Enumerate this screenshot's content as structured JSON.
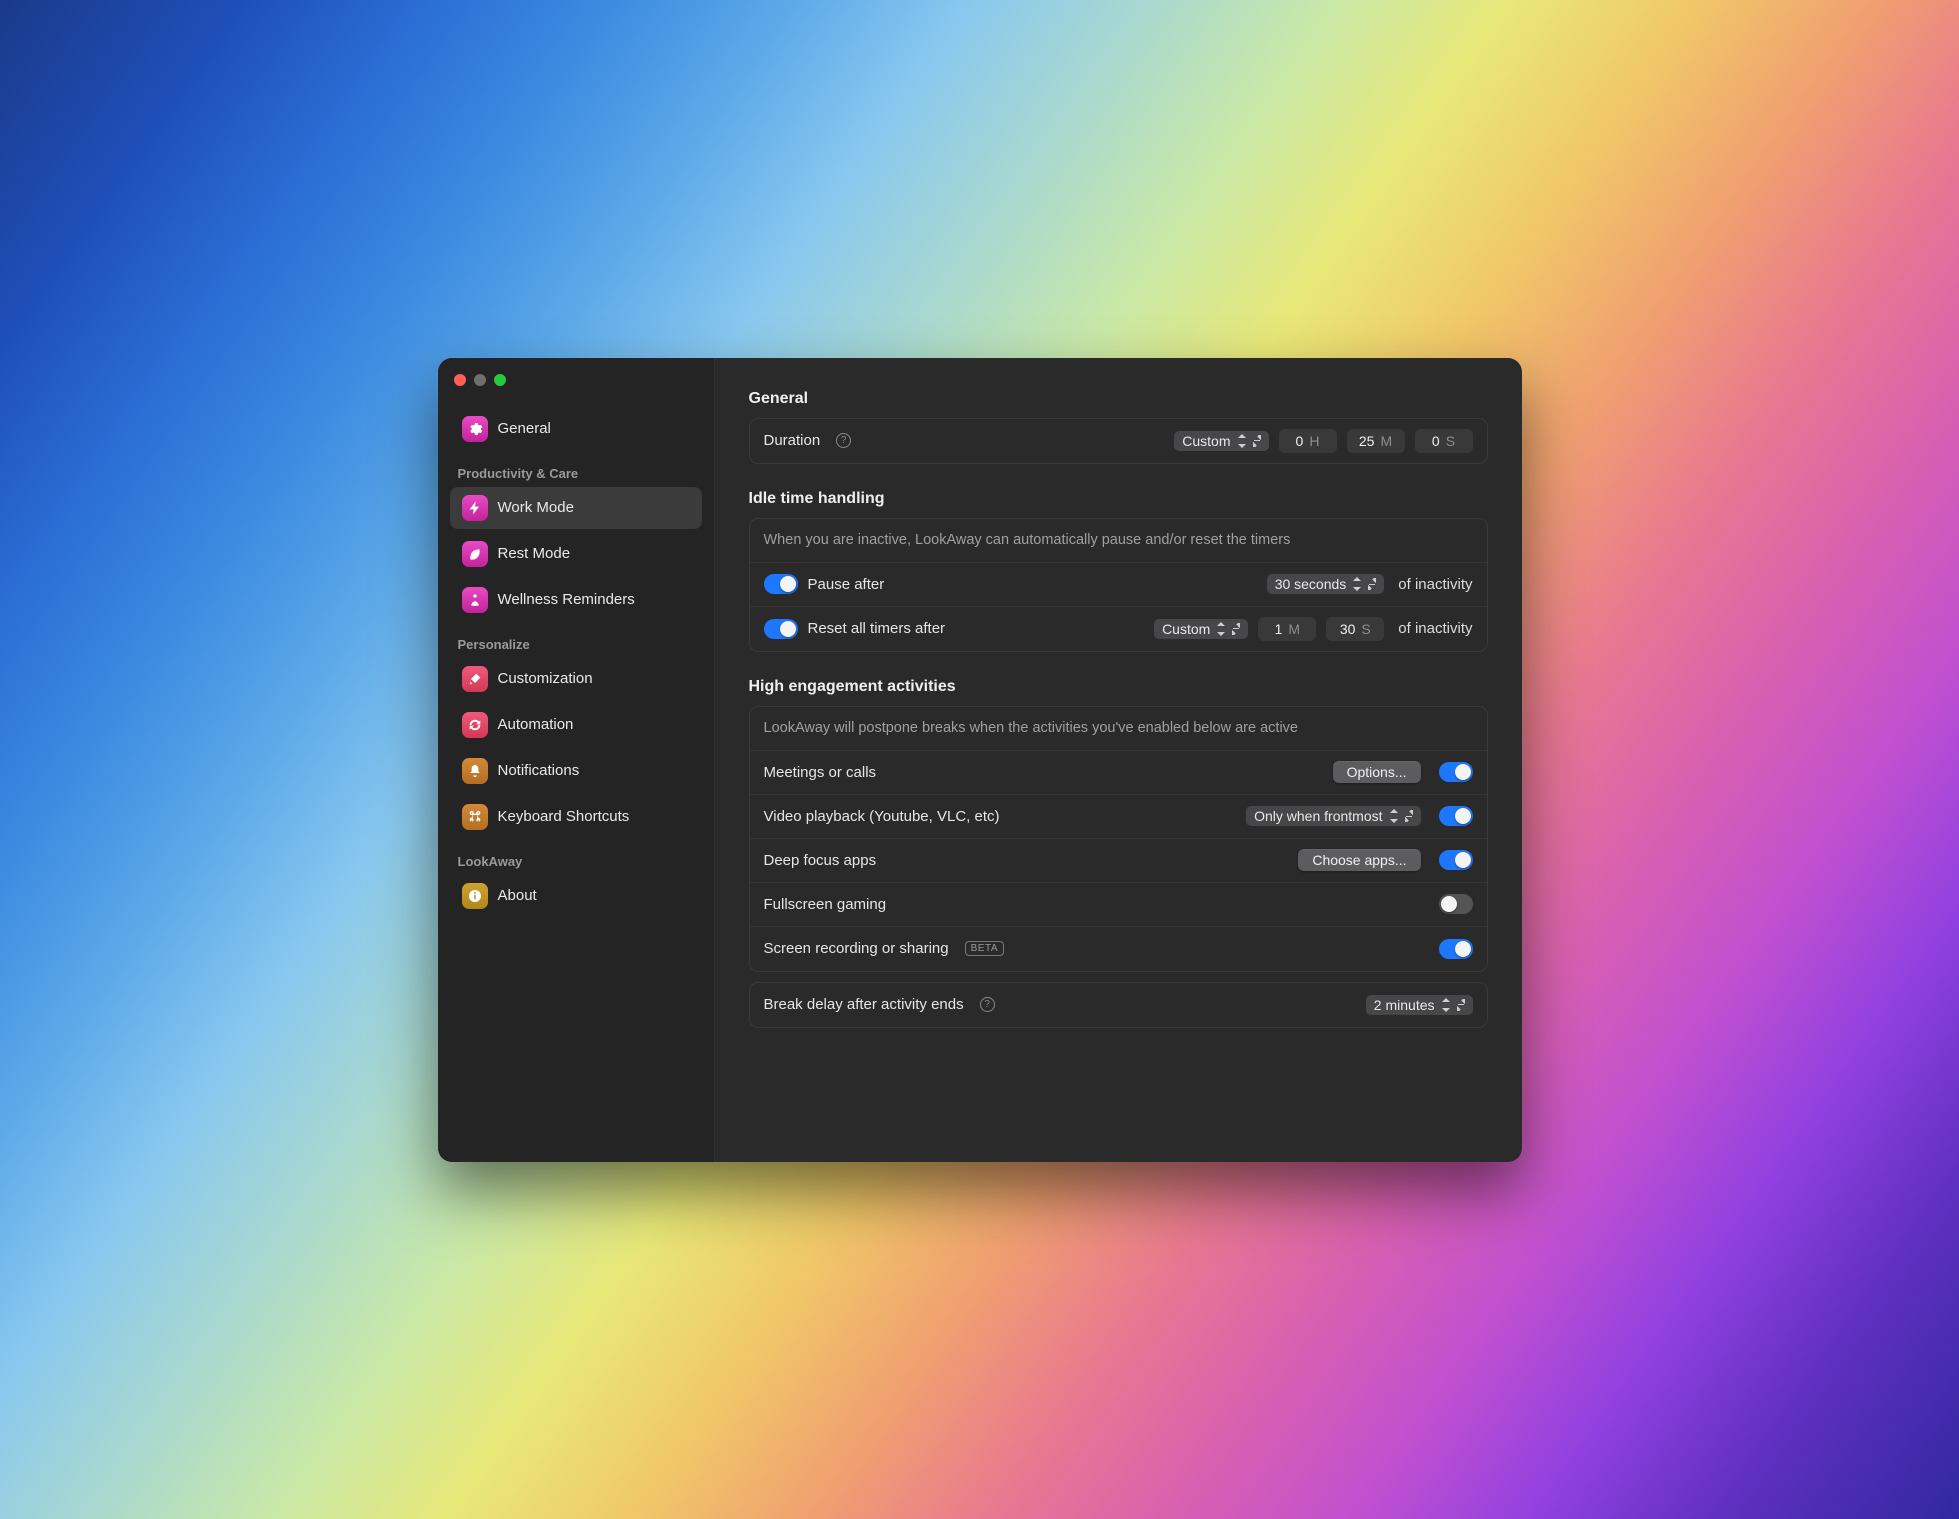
{
  "sidebar": {
    "general": "General",
    "groups": {
      "productivity": "Productivity & Care",
      "personalize": "Personalize",
      "lookaway": "LookAway"
    },
    "items": {
      "work_mode": "Work Mode",
      "rest_mode": "Rest Mode",
      "wellness": "Wellness Reminders",
      "customization": "Customization",
      "automation": "Automation",
      "notifications": "Notifications",
      "keyboard": "Keyboard Shortcuts",
      "about": "About"
    }
  },
  "sections": {
    "general": {
      "title": "General",
      "duration_label": "Duration",
      "duration_mode": "Custom",
      "h_val": "0",
      "h_unit": "H",
      "m_val": "25",
      "m_unit": "M",
      "s_val": "0",
      "s_unit": "S"
    },
    "idle": {
      "title": "Idle time handling",
      "desc": "When you are inactive, LookAway can automatically pause and/or reset the timers",
      "pause_label": "Pause after",
      "pause_value": "30 seconds",
      "suffix": "of inactivity",
      "reset_label": "Reset all timers after",
      "reset_mode": "Custom",
      "reset_m_val": "1",
      "reset_m_unit": "M",
      "reset_s_val": "30",
      "reset_s_unit": "S"
    },
    "engage": {
      "title": "High engagement activities",
      "desc": "LookAway will postpone breaks when the activities you've enabled below are active",
      "meetings": "Meetings or calls",
      "options_btn": "Options...",
      "video": "Video playback (Youtube, VLC, etc)",
      "video_mode": "Only when frontmost",
      "deep": "Deep focus apps",
      "choose_btn": "Choose apps...",
      "fullscreen": "Fullscreen gaming",
      "screenrec": "Screen recording or sharing",
      "beta": "BETA",
      "delay_label": "Break delay after activity ends",
      "delay_value": "2 minutes"
    }
  }
}
